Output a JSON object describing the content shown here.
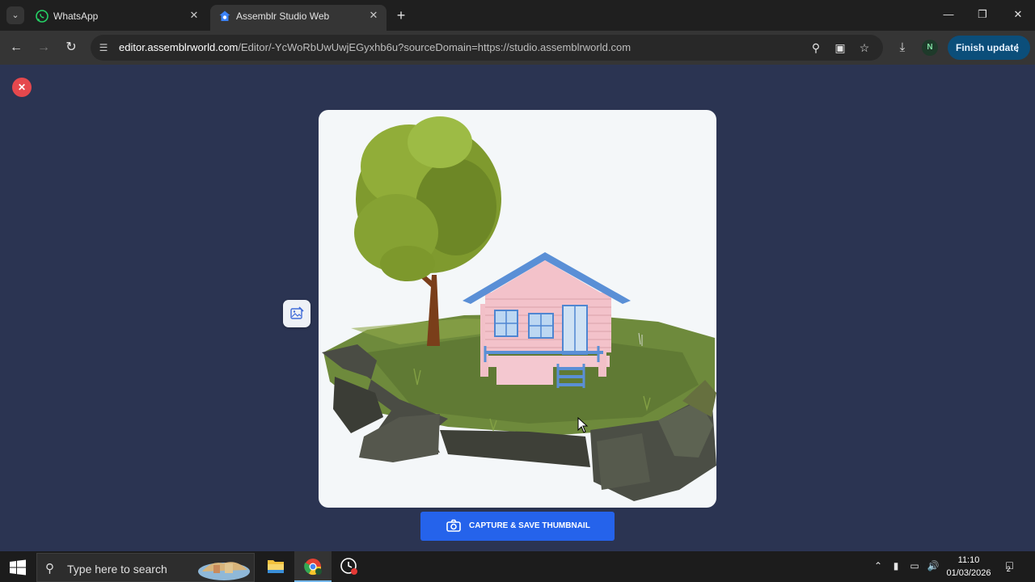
{
  "browser": {
    "tabs": [
      {
        "title": "WhatsApp",
        "active": false
      },
      {
        "title": "Assemblr Studio Web",
        "active": true
      }
    ],
    "url_host": "editor.assemblrworld.com",
    "url_path": "/Editor/-YcWoRbUwUwjEGyxhb6u?sourceDomain=https://studio.assemblrworld.com",
    "profile_initial": "N",
    "update_label": "Finish update"
  },
  "editor": {
    "capture_button_label": "CAPTURE & SAVE THUMBNAIL",
    "accent_color": "#2563eb",
    "close_color": "#e5484d",
    "background_color": "#2b3452"
  },
  "taskbar": {
    "search_placeholder": "Type here to search",
    "time": "11:10",
    "date": "01/03/2026",
    "notification_count": "2"
  }
}
